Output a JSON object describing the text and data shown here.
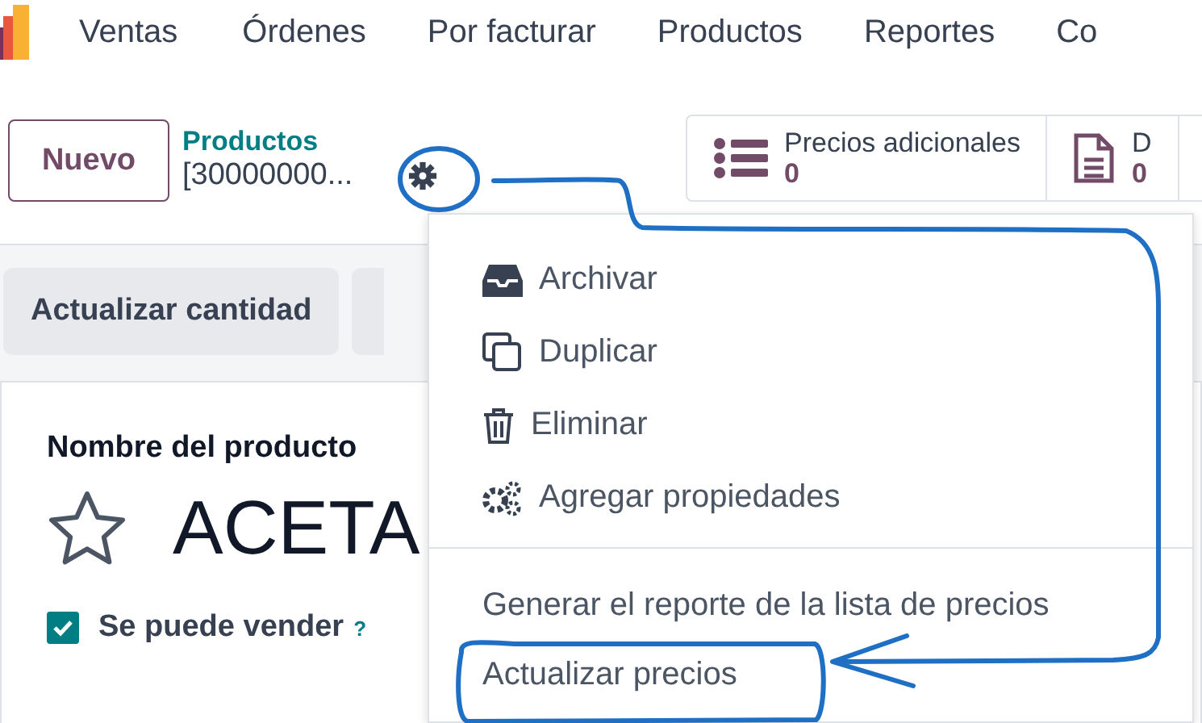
{
  "app": {
    "name": "Ventas"
  },
  "menu": [
    {
      "label": "Órdenes"
    },
    {
      "label": "Por facturar"
    },
    {
      "label": "Productos"
    },
    {
      "label": "Reportes"
    },
    {
      "label": "Co"
    }
  ],
  "control_panel": {
    "new_button": "Nuevo",
    "breadcrumb": {
      "parent": "Productos",
      "record": "[30000000..."
    },
    "smart_buttons": [
      {
        "kind": "list",
        "label": "Precios adicionales",
        "count": "0"
      },
      {
        "kind": "document",
        "label": "D",
        "count": "0"
      }
    ]
  },
  "actions": [
    {
      "label": "Actualizar cantidad"
    }
  ],
  "form": {
    "name_label": "Nombre del producto",
    "name": "ACETA",
    "favorite": false,
    "checkboxes": [
      {
        "label": "Se puede vender",
        "checked": true,
        "help": "?"
      }
    ]
  },
  "dropdown": {
    "groups": [
      [
        {
          "kind": "archive",
          "label": "Archivar"
        },
        {
          "kind": "duplicate",
          "label": "Duplicar"
        },
        {
          "kind": "delete",
          "label": "Eliminar"
        },
        {
          "kind": "properties",
          "label": "Agregar propiedades"
        }
      ],
      [
        {
          "kind": "text",
          "label": "Generar el reporte de la lista de precios"
        },
        {
          "kind": "text",
          "label": "Actualizar precios"
        }
      ]
    ]
  }
}
